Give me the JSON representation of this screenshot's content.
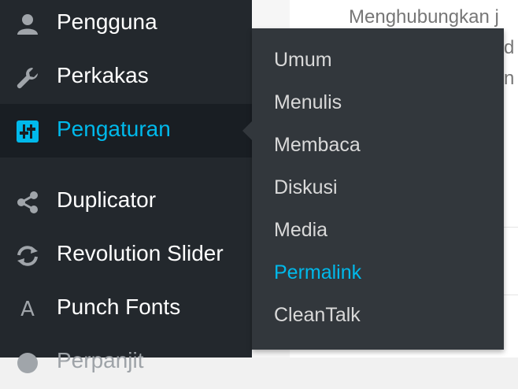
{
  "content": {
    "text": "Menghubungkan j",
    "fragments": [
      "d",
      "n"
    ]
  },
  "sidebar": {
    "items": [
      {
        "label": "Pengguna",
        "icon": "users-icon"
      },
      {
        "label": "Perkakas",
        "icon": "wrench-icon"
      },
      {
        "label": "Pengaturan",
        "icon": "settings-icon"
      },
      {
        "label": "Duplicator",
        "icon": "share-icon"
      },
      {
        "label": "Revolution Slider",
        "icon": "refresh-icon"
      },
      {
        "label": "Punch Fonts",
        "icon": "font-icon"
      },
      {
        "label": "Perpanjit",
        "icon": "circle-icon"
      }
    ]
  },
  "submenu": {
    "items": [
      "Umum",
      "Menulis",
      "Membaca",
      "Diskusi",
      "Media",
      "Permalink",
      "CleanTalk"
    ],
    "current": "Permalink"
  },
  "colors": {
    "sidebar_bg": "#23282d",
    "active_bg": "#191e23",
    "submenu_bg": "#32373c",
    "accent": "#00b9eb",
    "text": "#ffffff"
  }
}
